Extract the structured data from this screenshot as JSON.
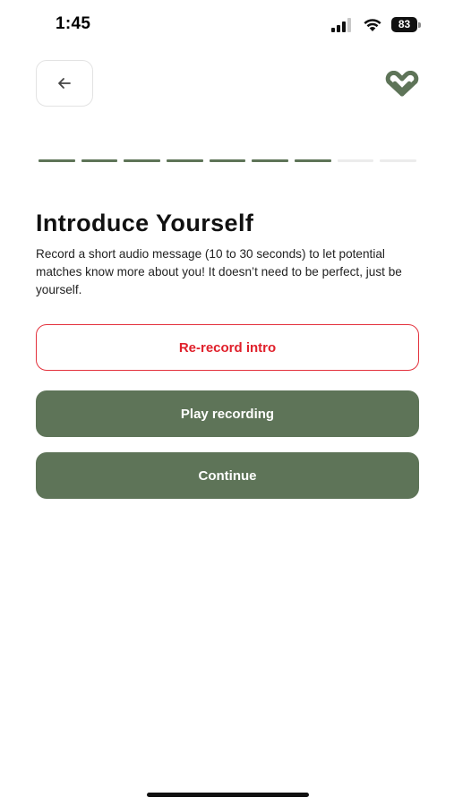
{
  "status_bar": {
    "time": "1:45",
    "battery": "83"
  },
  "header": {
    "back_icon": "arrow-left-icon",
    "logo_icon": "heart-link-logo-icon"
  },
  "progress": {
    "total_steps": 9,
    "completed_steps": 7,
    "active_color": "#5e7458",
    "inactive_color": "#ececec"
  },
  "main": {
    "title": "Introduce Yourself",
    "description": "Record a short audio message (10 to 30 seconds) to let potential matches know more about you! It doesn’t need to be perfect, just be yourself."
  },
  "actions": {
    "rerecord_label": "Re-record intro",
    "play_label": "Play recording",
    "continue_label": "Continue"
  },
  "colors": {
    "brand_green": "#5e7458",
    "danger_red": "#e0202b"
  }
}
